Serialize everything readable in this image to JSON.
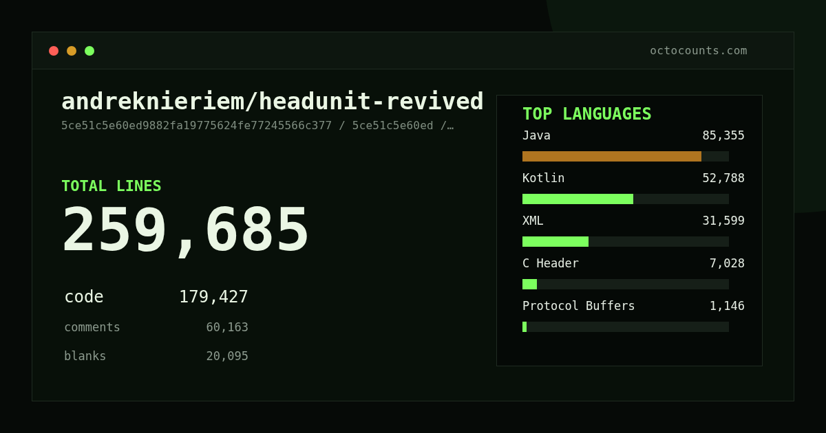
{
  "window": {
    "controls": [
      {
        "color": "#ff5f57"
      },
      {
        "color": "#d79c27"
      },
      {
        "color": "#7cff5e"
      }
    ],
    "domain": "octocounts.com"
  },
  "repo": {
    "name": "andreknieriem/headunit-revived",
    "path": "5ce51c5e60ed9882fa19775624fe77245566c377 / 5ce51c5e60ed /…"
  },
  "total": {
    "label": "TOTAL LINES",
    "value": "259,685"
  },
  "stats": [
    {
      "kind": "primary",
      "label": "code",
      "value": "179,427"
    },
    {
      "kind": "secondary",
      "label": "comments",
      "value": "60,163"
    },
    {
      "kind": "secondary",
      "label": "blanks",
      "value": "20,095"
    }
  ],
  "languages": {
    "title": "TOP LANGUAGES",
    "items": [
      {
        "name": "Java",
        "value": "85,355",
        "level": 0.867,
        "color": "#b07520"
      },
      {
        "name": "Kotlin",
        "value": "52,788",
        "level": 0.537,
        "color": "#7cff5e"
      },
      {
        "name": "XML",
        "value": "31,599",
        "level": 0.32,
        "color": "#7cff5e"
      },
      {
        "name": "C Header",
        "value": "7,028",
        "level": 0.07,
        "color": "#7cff5e"
      },
      {
        "name": "Protocol Buffers",
        "value": "1,146",
        "level": 0.02,
        "color": "#7cff5e"
      }
    ]
  }
}
